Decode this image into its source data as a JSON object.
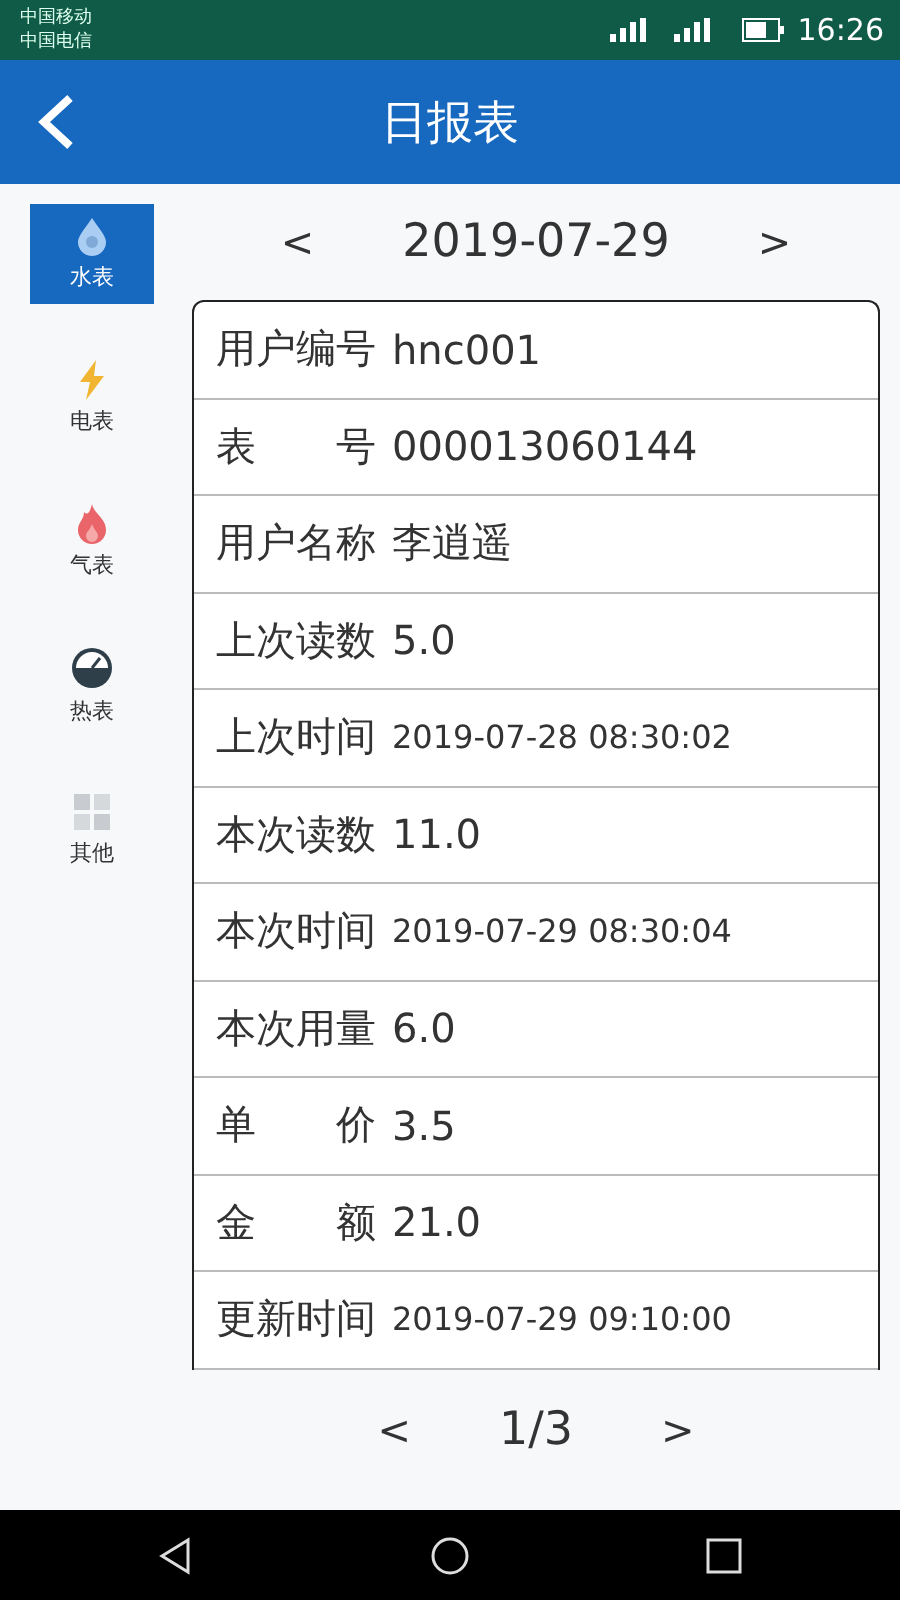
{
  "status_bar": {
    "carriers": [
      "中国移动",
      "中国电信"
    ],
    "time": "16:26"
  },
  "header": {
    "title": "日报表"
  },
  "sidebar": {
    "items": [
      {
        "label": "水表",
        "kind": "water",
        "selected": true
      },
      {
        "label": "电表",
        "kind": "electric",
        "selected": false
      },
      {
        "label": "气表",
        "kind": "gas",
        "selected": false
      },
      {
        "label": "热表",
        "kind": "heat",
        "selected": false
      },
      {
        "label": "其他",
        "kind": "other",
        "selected": false
      }
    ]
  },
  "date_nav": {
    "prev": "<",
    "date": "2019-07-29",
    "next": ">"
  },
  "record": [
    {
      "label": "用户编号",
      "value": "hnc001",
      "kind": "text"
    },
    {
      "label": "表　　号",
      "value": "000013060144",
      "kind": "text"
    },
    {
      "label": "用户名称",
      "value": "李逍遥",
      "kind": "text"
    },
    {
      "label": "上次读数",
      "value": "5.0",
      "kind": "text"
    },
    {
      "label": "上次时间",
      "value": "2019-07-28 08:30:02",
      "kind": "datetime"
    },
    {
      "label": "本次读数",
      "value": "11.0",
      "kind": "text"
    },
    {
      "label": "本次时间",
      "value": "2019-07-29 08:30:04",
      "kind": "datetime"
    },
    {
      "label": "本次用量",
      "value": "6.0",
      "kind": "text"
    },
    {
      "label": "单　　价",
      "value": "3.5",
      "kind": "text"
    },
    {
      "label": "金　　额",
      "value": "21.0",
      "kind": "text"
    },
    {
      "label": "更新时间",
      "value": "2019-07-29 09:10:00",
      "kind": "datetime"
    }
  ],
  "pager": {
    "prev": "<",
    "page": "1/3",
    "next": ">"
  }
}
